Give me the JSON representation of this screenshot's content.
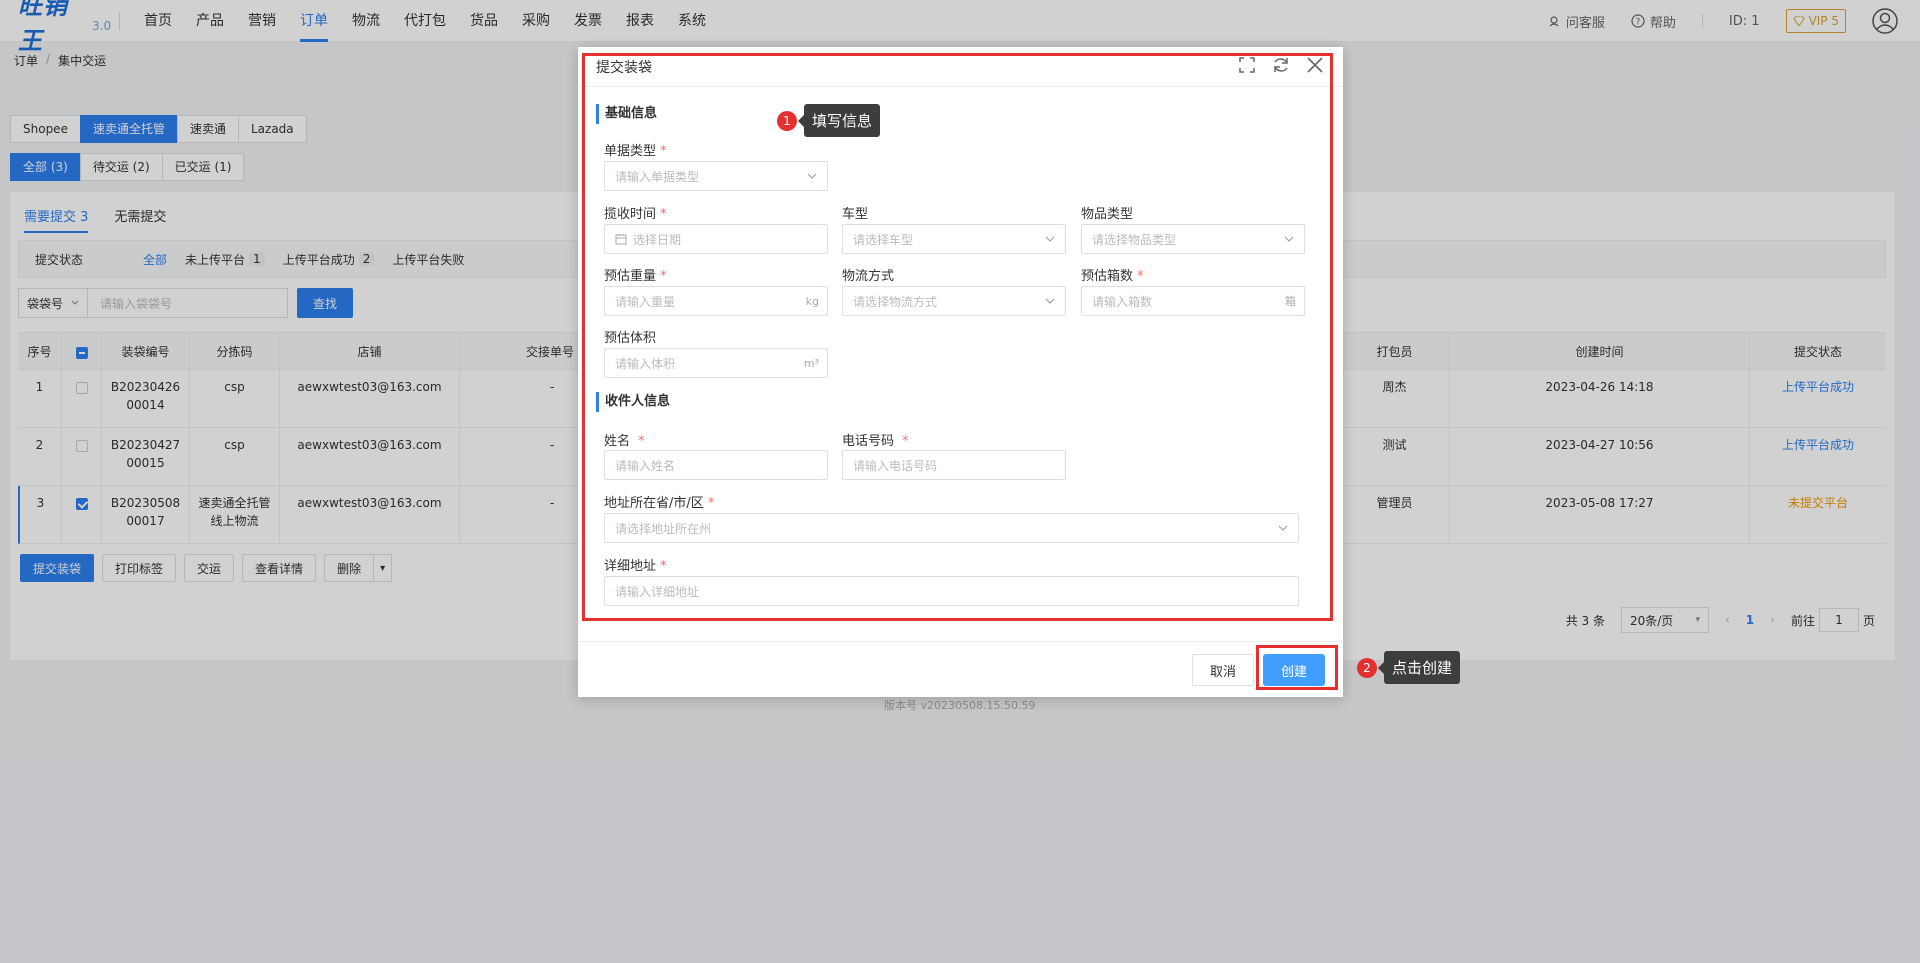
{
  "app": {
    "logo": "旺销王",
    "version": "3.0"
  },
  "nav": [
    "首页",
    "产品",
    "营销",
    "订单",
    "物流",
    "代打包",
    "货品",
    "采购",
    "发票",
    "报表",
    "系统"
  ],
  "nav_active_index": 3,
  "top_right": {
    "service": "问客服",
    "help": "帮助",
    "id": "ID: 1",
    "vip": "VIP 5"
  },
  "breadcrumb": [
    "订单",
    "集中交运"
  ],
  "platform_tabs": [
    "Shopee",
    "速卖通全托管",
    "速卖通",
    "Lazada"
  ],
  "status_tabs": [
    "全部 (3)",
    "待交运 (2)",
    "已交运 (1)"
  ],
  "sub_tabs": [
    "需要提交 3",
    "无需提交"
  ],
  "submit_status": {
    "label": "提交状态",
    "options": [
      {
        "label": "全部",
        "count": ""
      },
      {
        "label": "未上传平台",
        "count": "1"
      },
      {
        "label": "上传平台成功",
        "count": "2"
      },
      {
        "label": "上传平台失败",
        "count": ""
      }
    ]
  },
  "search": {
    "select": "袋袋号",
    "placeholder": "请输入袋袋号",
    "button": "查找"
  },
  "table": {
    "headers": [
      "序号",
      "",
      "装袋编号",
      "分拣码",
      "店铺",
      "交接单号",
      "打包员",
      "创建时间",
      "提交状态"
    ],
    "rows": [
      {
        "no": "1",
        "bag": "B20230426 00014",
        "code": "csp",
        "store": "aewxwtest03@163.com",
        "handover": "-",
        "packer": "周杰",
        "time": "2023-04-26 14:18",
        "status": "上传平台成功"
      },
      {
        "no": "2",
        "bag": "B20230427 00015",
        "code": "csp",
        "store": "aewxwtest03@163.com",
        "handover": "-",
        "packer": "测试",
        "time": "2023-04-27 10:56",
        "status": "上传平台成功"
      },
      {
        "no": "3",
        "bag": "B20230508 00017",
        "code": "速卖通全托管线上物流",
        "store": "aewxwtest03@163.com",
        "handover": "-",
        "packer": "管理员",
        "time": "2023-05-08 17:27",
        "status": "未提交平台"
      }
    ]
  },
  "actions": [
    "提交装袋",
    "打印标签",
    "交运",
    "查看详情",
    "删除"
  ],
  "pager": {
    "total": "共 3 条",
    "size": "20条/页",
    "page": "1",
    "goto": "前往",
    "page_unit": "页"
  },
  "version": "版本号 v20230508.15.50.59",
  "dialog": {
    "title": "提交装袋",
    "section_basic": "基础信息",
    "section_receiver": "收件人信息",
    "fields": {
      "doc_type": {
        "label": "单据类型",
        "placeholder": "请输入单据类型"
      },
      "pickup_time": {
        "label": "揽收时间",
        "placeholder": "选择日期"
      },
      "car_type": {
        "label": "车型",
        "placeholder": "请选择车型"
      },
      "goods_type": {
        "label": "物品类型",
        "placeholder": "请选择物品类型"
      },
      "weight": {
        "label": "预估重量",
        "placeholder": "请输入重量",
        "unit": "kg"
      },
      "logistics": {
        "label": "物流方式",
        "placeholder": "请选择物流方式"
      },
      "boxes": {
        "label": "预估箱数",
        "placeholder": "请输入箱数",
        "unit": "箱"
      },
      "volume": {
        "label": "预估体积",
        "placeholder": "请输入体积",
        "unit": "m³"
      },
      "name": {
        "label": "姓名",
        "placeholder": "请输入姓名"
      },
      "phone": {
        "label": "电话号码",
        "placeholder": "请输入电话号码"
      },
      "region": {
        "label": "地址所在省/市/区",
        "placeholder": "请选择地址所在州"
      },
      "address": {
        "label": "详细地址",
        "placeholder": "请输入详细地址"
      }
    },
    "cancel": "取消",
    "create": "创建"
  },
  "annotations": [
    {
      "num": "1",
      "text": "填写信息"
    },
    {
      "num": "2",
      "text": "点击创建"
    }
  ],
  "colors": {
    "primary": "#2d7ff0",
    "annotation": "#e53030",
    "warning": "#f39800"
  }
}
